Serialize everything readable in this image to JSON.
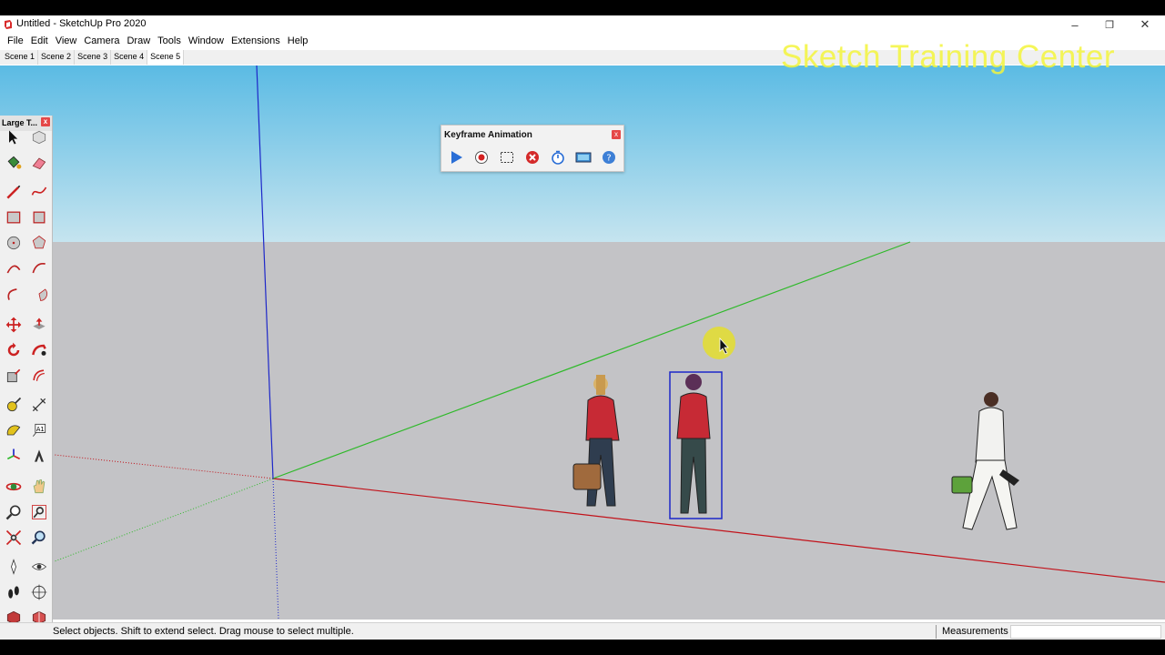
{
  "window": {
    "title": "Untitled - SketchUp Pro 2020",
    "minimize_glyph": "–",
    "restore_glyph": "❐",
    "close_glyph": "✕"
  },
  "menu": [
    "File",
    "Edit",
    "View",
    "Camera",
    "Draw",
    "Tools",
    "Window",
    "Extensions",
    "Help"
  ],
  "scenes": {
    "tabs": [
      "Scene 1",
      "Scene 2",
      "Scene 3",
      "Scene 4",
      "Scene 5"
    ],
    "active": "Scene 5"
  },
  "watermark": "Sketch Training Center",
  "toolbar": {
    "title": "Large T...",
    "close_glyph": "x",
    "tools": [
      {
        "name": "select-icon"
      },
      {
        "name": "make-component-icon"
      },
      {
        "name": "paint-bucket-icon"
      },
      {
        "name": "eraser-icon"
      },
      {
        "name": "line-icon"
      },
      {
        "name": "freehand-icon"
      },
      {
        "name": "rectangle-icon"
      },
      {
        "name": "rotated-rectangle-icon"
      },
      {
        "name": "circle-icon"
      },
      {
        "name": "polygon-icon"
      },
      {
        "name": "arc-icon"
      },
      {
        "name": "two-point-arc-icon"
      },
      {
        "name": "three-point-arc-icon"
      },
      {
        "name": "pie-icon"
      },
      {
        "name": "move-icon"
      },
      {
        "name": "push-pull-icon"
      },
      {
        "name": "rotate-icon"
      },
      {
        "name": "follow-me-icon"
      },
      {
        "name": "scale-icon"
      },
      {
        "name": "offset-icon"
      },
      {
        "name": "tape-measure-icon"
      },
      {
        "name": "dimension-icon"
      },
      {
        "name": "protractor-icon"
      },
      {
        "name": "text-icon"
      },
      {
        "name": "axes-icon"
      },
      {
        "name": "3d-text-icon"
      },
      {
        "name": "orbit-icon"
      },
      {
        "name": "pan-icon"
      },
      {
        "name": "zoom-icon"
      },
      {
        "name": "zoom-window-icon"
      },
      {
        "name": "zoom-extents-icon"
      },
      {
        "name": "previous-view-icon"
      },
      {
        "name": "position-camera-icon"
      },
      {
        "name": "look-around-icon"
      },
      {
        "name": "walk-icon"
      },
      {
        "name": "section-plane-icon"
      },
      {
        "name": "3d-warehouse-icon"
      },
      {
        "name": "extension-warehouse-icon"
      }
    ]
  },
  "keyframe_panel": {
    "title": "Keyframe Animation",
    "close_glyph": "x",
    "buttons": [
      {
        "name": "play-icon"
      },
      {
        "name": "record-icon"
      },
      {
        "name": "select-scenes-icon"
      },
      {
        "name": "delete-icon"
      },
      {
        "name": "timer-icon"
      },
      {
        "name": "export-video-icon"
      },
      {
        "name": "help-icon"
      }
    ]
  },
  "status": {
    "text": "Select objects. Shift to extend select. Drag mouse to select multiple.",
    "measurements_label": "Measurements",
    "measurements_value": ""
  },
  "colors": {
    "sky_top": "#5bbbe4",
    "sky_bottom": "#c5e4ef",
    "ground": "#c3c3c6",
    "axis_red": "#c2121a",
    "axis_green": "#2fb92a",
    "axis_blue": "#1d27c9",
    "selection": "#1d27c9",
    "cursor_highlight": "#e6e023"
  }
}
